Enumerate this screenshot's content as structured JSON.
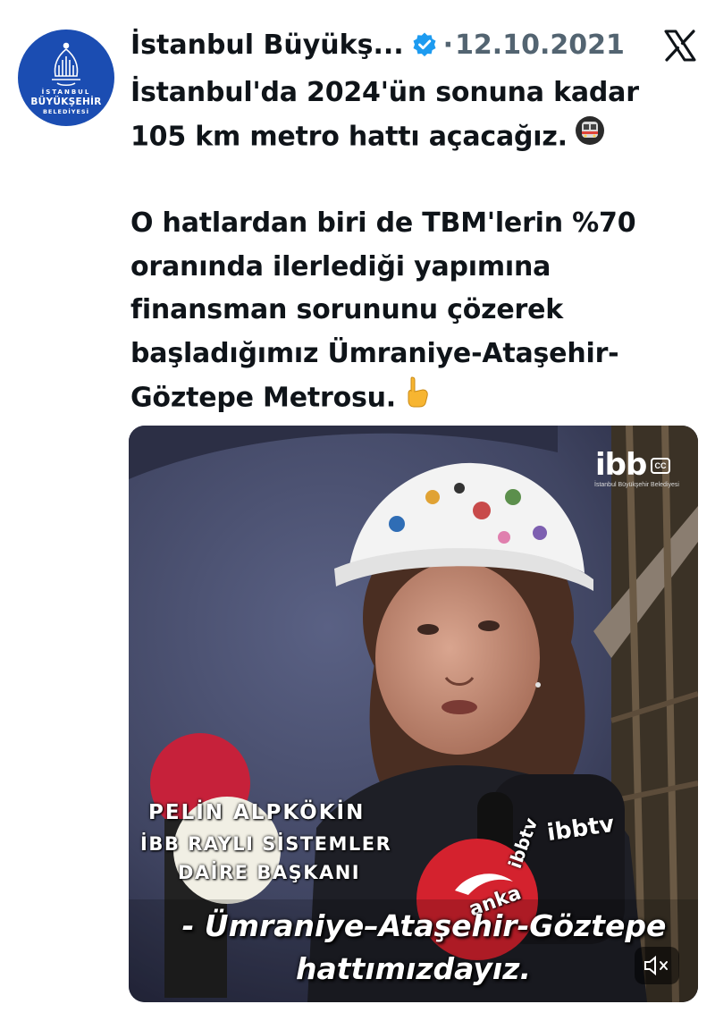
{
  "header": {
    "account_name": "İstanbul Büyükş...",
    "separator": "·",
    "date": "12.10.2021",
    "verified_icon": "verified-badge-icon",
    "platform_icon": "x-logo-icon"
  },
  "avatar": {
    "line1": "İSTANBUL",
    "line2": "BÜYÜKŞEHİR",
    "line3": "BELEDİYESİ",
    "background": "#1b4db2"
  },
  "tweet": {
    "line1": "İstanbul'da 2024'ün sonuna kadar",
    "line2": "105 km metro hattı açacağız.",
    "line3": "O hatlardan biri de TBM'lerin %70",
    "line4": "oranında ilerlediği yapımına",
    "line5": "finansman sorununu çözerek",
    "line6": "başladığımız Ümraniye-Ataşehir-",
    "line7": "Göztepe Metrosu.",
    "emoji1": "metro-emoji-icon",
    "emoji2": "pointing-down-emoji-icon"
  },
  "media": {
    "watermark": "ibb",
    "watermark_sub": "İstanbul Büyükşehir Belediyesi",
    "cc_label": "CC",
    "name_line1": "PELİN ALPKÖKİN",
    "name_line2": "İBB RAYLI SİSTEMLER",
    "name_line3": "DAİRE BAŞKANI",
    "caption_line1": "- Ümraniye–Ataşehir-Göztepe",
    "caption_line2": "hattımızdayız.",
    "mic1_label": "ibbtv",
    "mic2_label": "ibbtv",
    "mic3_label": "anka",
    "mute_icon": "mute-speaker-icon"
  },
  "colors": {
    "text": "#0f1419",
    "secondary": "#536471",
    "verified": "#1d9bf0"
  }
}
